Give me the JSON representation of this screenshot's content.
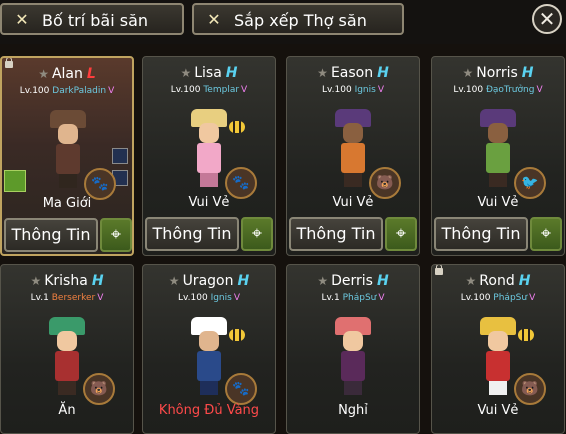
{
  "header": {
    "layout_label": "Bố trí bãi săn",
    "arrange_label": "Sắp xếp Thợ săn",
    "button_icon": "crossed-swords-icon",
    "close_icon": "close-icon"
  },
  "cards": [
    {
      "name": "Alan",
      "tier": "L",
      "level": "Lv.100",
      "class": "DarkPaladin",
      "v": "V",
      "status": "Ma Giới",
      "info": "Thông Tin"
    },
    {
      "name": "Lisa",
      "tier": "H",
      "level": "Lv.100",
      "class": "Templar",
      "v": "V",
      "status": "Vui Vẻ",
      "info": "Thông Tin"
    },
    {
      "name": "Eason",
      "tier": "H",
      "level": "Lv.100",
      "class": "Ignis",
      "v": "V",
      "status": "Vui Vẻ",
      "info": "Thông Tin"
    },
    {
      "name": "Norris",
      "tier": "H",
      "level": "Lv.100",
      "class": "ĐạoTrưởng",
      "v": "V",
      "status": "Vui Vẻ",
      "info": "Thông Tin"
    },
    {
      "name": "Krisha",
      "tier": "H",
      "level": "Lv.1",
      "class": "Berserker",
      "v": "V",
      "status": "Ăn"
    },
    {
      "name": "Uragon",
      "tier": "H",
      "level": "Lv.100",
      "class": "Ignis",
      "v": "V",
      "status": "Không Đủ Vàng"
    },
    {
      "name": "Derris",
      "tier": "H",
      "level": "Lv.1",
      "class": "PhápSư",
      "v": "V",
      "status": "Nghỉ"
    },
    {
      "name": "Rond",
      "tier": "H",
      "level": "Lv.100",
      "class": "PhápSư",
      "v": "V",
      "status": "Vui Vẻ"
    }
  ],
  "colors": {
    "tier_h": "#5ad2f0",
    "tier_l": "#ff3d3d",
    "class_text": "#6cc9e0",
    "v_badge": "#f080f0",
    "warn": "#ff4a4a"
  }
}
